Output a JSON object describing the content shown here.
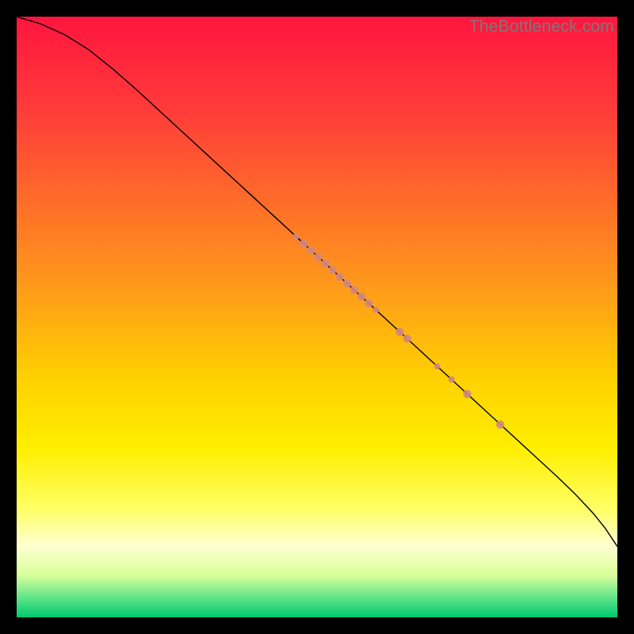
{
  "watermark": "TheBottleneck.com",
  "chart_data": {
    "type": "line",
    "title": "",
    "xlabel": "",
    "ylabel": "",
    "xlim": [
      0,
      100
    ],
    "ylim": [
      0,
      100
    ],
    "background_gradient": {
      "stops": [
        {
          "offset": 0.0,
          "color": "#ff153e"
        },
        {
          "offset": 0.15,
          "color": "#ff3a3a"
        },
        {
          "offset": 0.3,
          "color": "#ff6a2a"
        },
        {
          "offset": 0.45,
          "color": "#ff9a1a"
        },
        {
          "offset": 0.6,
          "color": "#ffd000"
        },
        {
          "offset": 0.72,
          "color": "#ffef00"
        },
        {
          "offset": 0.82,
          "color": "#ffff66"
        },
        {
          "offset": 0.88,
          "color": "#ffffd0"
        },
        {
          "offset": 0.93,
          "color": "#d8ff9a"
        },
        {
          "offset": 0.965,
          "color": "#66e68a"
        },
        {
          "offset": 1.0,
          "color": "#00c86f"
        }
      ]
    },
    "series": [
      {
        "name": "curve",
        "color": "#000000",
        "width": 1.4,
        "points": [
          {
            "x": 0.0,
            "y": 100.0
          },
          {
            "x": 4.0,
            "y": 98.8
          },
          {
            "x": 8.0,
            "y": 97.0
          },
          {
            "x": 12.0,
            "y": 94.5
          },
          {
            "x": 16.0,
            "y": 91.3
          },
          {
            "x": 20.0,
            "y": 87.8
          },
          {
            "x": 25.0,
            "y": 83.2
          },
          {
            "x": 30.0,
            "y": 78.6
          },
          {
            "x": 35.0,
            "y": 74.0
          },
          {
            "x": 40.0,
            "y": 69.4
          },
          {
            "x": 45.0,
            "y": 64.8
          },
          {
            "x": 50.0,
            "y": 60.2
          },
          {
            "x": 55.0,
            "y": 55.6
          },
          {
            "x": 60.0,
            "y": 51.0
          },
          {
            "x": 65.0,
            "y": 46.4
          },
          {
            "x": 70.0,
            "y": 41.8
          },
          {
            "x": 75.0,
            "y": 37.2
          },
          {
            "x": 80.0,
            "y": 32.6
          },
          {
            "x": 85.0,
            "y": 28.0
          },
          {
            "x": 90.0,
            "y": 23.4
          },
          {
            "x": 93.0,
            "y": 20.5
          },
          {
            "x": 96.0,
            "y": 17.3
          },
          {
            "x": 98.0,
            "y": 14.8
          },
          {
            "x": 100.0,
            "y": 11.8
          }
        ]
      }
    ],
    "scatter": {
      "name": "highlighted-points",
      "color": "#d4887e",
      "radius_small": 4.0,
      "radius_large": 5.2,
      "points": [
        {
          "x": 46.5,
          "y": 63.4,
          "r": "small"
        },
        {
          "x": 47.8,
          "y": 62.2,
          "r": "large"
        },
        {
          "x": 49.0,
          "y": 61.1,
          "r": "large"
        },
        {
          "x": 50.2,
          "y": 60.0,
          "r": "large"
        },
        {
          "x": 51.4,
          "y": 58.9,
          "r": "large"
        },
        {
          "x": 52.6,
          "y": 57.8,
          "r": "large"
        },
        {
          "x": 53.8,
          "y": 56.7,
          "r": "large"
        },
        {
          "x": 55.0,
          "y": 55.6,
          "r": "large"
        },
        {
          "x": 56.2,
          "y": 54.5,
          "r": "large"
        },
        {
          "x": 57.4,
          "y": 53.4,
          "r": "large"
        },
        {
          "x": 58.6,
          "y": 52.3,
          "r": "large"
        },
        {
          "x": 59.8,
          "y": 51.2,
          "r": "small"
        },
        {
          "x": 63.8,
          "y": 47.5,
          "r": "large"
        },
        {
          "x": 65.0,
          "y": 46.4,
          "r": "large"
        },
        {
          "x": 70.0,
          "y": 41.8,
          "r": "small"
        },
        {
          "x": 72.4,
          "y": 39.6,
          "r": "small"
        },
        {
          "x": 75.0,
          "y": 37.2,
          "r": "large"
        },
        {
          "x": 80.5,
          "y": 32.1,
          "r": "large"
        }
      ]
    }
  }
}
